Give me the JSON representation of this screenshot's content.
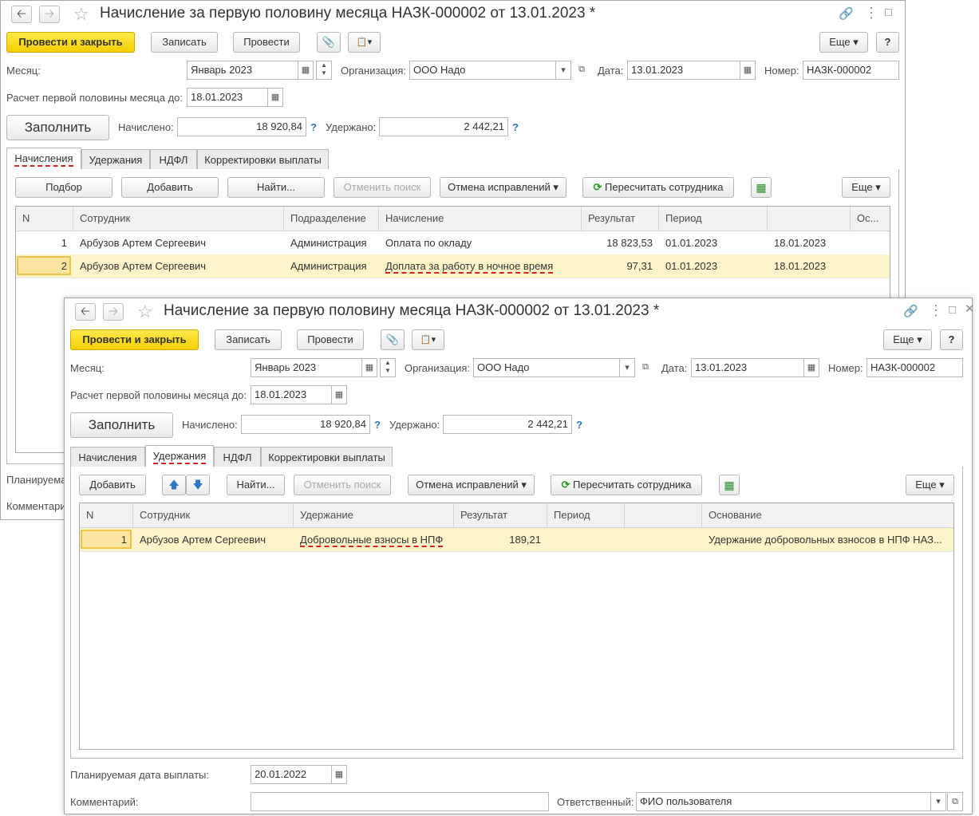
{
  "w1": {
    "title": "Начисление за первую половину месяца НАЗК-000002 от 13.01.2023 *",
    "toolbar": {
      "post_close": "Провести и закрыть",
      "write": "Записать",
      "post": "Провести",
      "more": "Еще",
      "help": "?"
    },
    "fields": {
      "month_label": "Месяц:",
      "month": "Январь 2023",
      "org_label": "Организация:",
      "org": "ООО Надо",
      "date_label": "Дата:",
      "date": "13.01.2023",
      "number_label": "Номер:",
      "number": "НАЗК-000002",
      "calc_until_label": "Расчет первой половины месяца до:",
      "calc_until": "18.01.2023",
      "fill": "Заполнить",
      "accrued_label": "Начислено:",
      "accrued": "18 920,84",
      "withheld_label": "Удержано:",
      "withheld": "2 442,21",
      "q": "?"
    },
    "tabs": [
      "Начисления",
      "Удержания",
      "НДФЛ",
      "Корректировки выплаты"
    ],
    "tab_toolbar": {
      "pick": "Подбор",
      "add": "Добавить",
      "find": "Найти...",
      "cancel_search": "Отменить поиск",
      "cancel_fix": "Отмена исправлений",
      "recalc": "Пересчитать сотрудника",
      "more": "Еще"
    },
    "columns": [
      "N",
      "Сотрудник",
      "Подразделение",
      "Начисление",
      "Результат",
      "Период",
      "",
      "Ос..."
    ],
    "rows": [
      {
        "n": "1",
        "employee": "Арбузов Артем Сергеевич",
        "dept": "Администрация",
        "accrual": "Оплата по окладу",
        "result": "18 823,53",
        "from": "01.01.2023",
        "to": "18.01.2023"
      },
      {
        "n": "2",
        "employee": "Арбузов Артем Сергеевич",
        "dept": "Администрация",
        "accrual": "Доплата за работу в ночное время",
        "result": "97,31",
        "from": "01.01.2023",
        "to": "18.01.2023"
      }
    ],
    "bottom": {
      "planned": "Планируема",
      "comment": "Комментари"
    }
  },
  "w2": {
    "title": "Начисление за первую половину месяца НАЗК-000002 от 13.01.2023 *",
    "toolbar": {
      "post_close": "Провести и закрыть",
      "write": "Записать",
      "post": "Провести",
      "more": "Еще",
      "help": "?"
    },
    "fields": {
      "month_label": "Месяц:",
      "month": "Январь 2023",
      "org_label": "Организация:",
      "org": "ООО Надо",
      "date_label": "Дата:",
      "date": "13.01.2023",
      "number_label": "Номер:",
      "number": "НАЗК-000002",
      "calc_until_label": "Расчет первой половины месяца до:",
      "calc_until": "18.01.2023",
      "fill": "Заполнить",
      "accrued_label": "Начислено:",
      "accrued": "18 920,84",
      "withheld_label": "Удержано:",
      "withheld": "2 442,21",
      "q": "?"
    },
    "tabs": [
      "Начисления",
      "Удержания",
      "НДФЛ",
      "Корректировки выплаты"
    ],
    "tab_toolbar": {
      "add": "Добавить",
      "find": "Найти...",
      "cancel_search": "Отменить поиск",
      "cancel_fix": "Отмена исправлений",
      "recalc": "Пересчитать сотрудника",
      "more": "Еще"
    },
    "columns": [
      "N",
      "Сотрудник",
      "Удержание",
      "Результат",
      "Период",
      "",
      "Основание"
    ],
    "rows": [
      {
        "n": "1",
        "employee": "Арбузов Артем Сергеевич",
        "deduction": "Добровольные взносы в НПФ",
        "result": "189,21",
        "from": "",
        "to": "",
        "basis": "Удержание добровольных взносов в НПФ НАЗ..."
      }
    ],
    "bottom": {
      "planned_label": "Планируемая дата выплаты:",
      "planned": "20.01.2022",
      "comment_label": "Комментарий:",
      "comment": "",
      "resp_label": "Ответственный:",
      "resp": "ФИО пользователя"
    }
  }
}
